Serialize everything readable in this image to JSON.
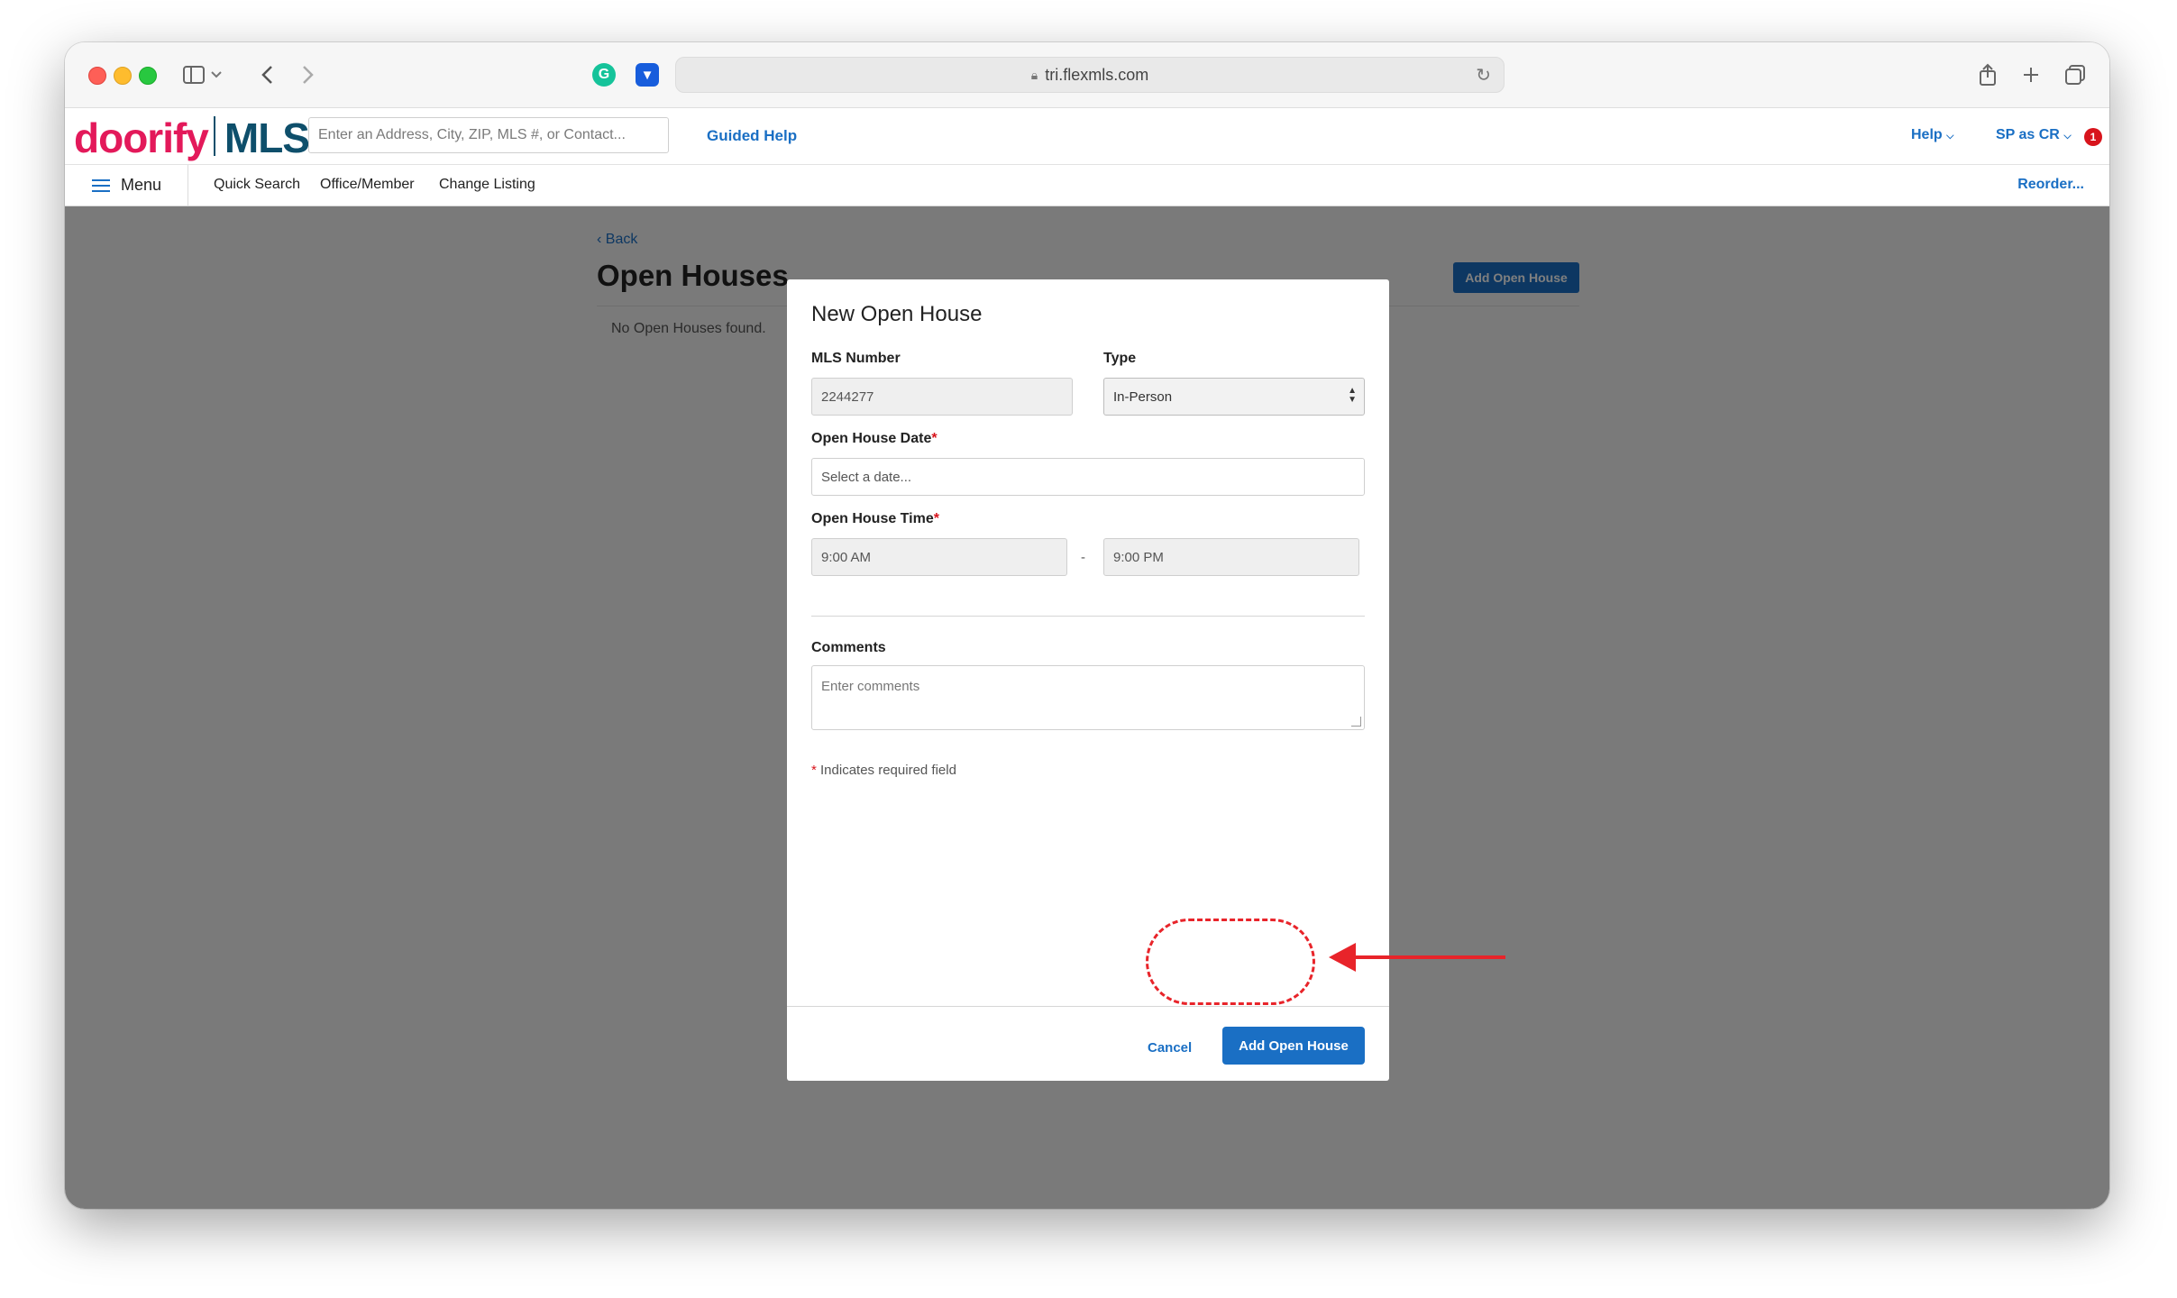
{
  "browser": {
    "url": "tri.flexmls.com",
    "icons": [
      "sidebar-icon",
      "chevron-down-icon",
      "back-icon",
      "forward-icon",
      "grammarly-icon",
      "bitwarden-icon",
      "lock-icon",
      "reload-icon",
      "share-icon",
      "new-tab-icon",
      "tabs-icon"
    ]
  },
  "header": {
    "logo_part1": "doorify",
    "logo_part2": "MLS",
    "search_placeholder": "Enter an Address, City, ZIP, MLS #, or Contact...",
    "guided_help": "Guided Help",
    "help": "Help",
    "user": "SP as CR",
    "notification_count": "1"
  },
  "nav": {
    "menu": "Menu",
    "items": [
      "Quick Search",
      "Office/Member",
      "Change Listing"
    ],
    "reorder": "Reorder..."
  },
  "page": {
    "back": "Back",
    "title": "Open Houses",
    "add_button": "Add Open House",
    "empty_text": "No Open Houses found."
  },
  "modal": {
    "title": "New Open House",
    "mls_label": "MLS Number",
    "mls_value": "2244277",
    "type_label": "Type",
    "type_value": "In-Person",
    "date_label": "Open House Date",
    "date_placeholder": "Select a date...",
    "time_label": "Open House Time",
    "time_start": "9:00 AM",
    "time_separator": "-",
    "time_end": "9:00 PM",
    "comments_label": "Comments",
    "comments_placeholder": "Enter comments",
    "required_mark": "*",
    "required_note": "Indicates required field",
    "cancel": "Cancel",
    "submit": "Add Open House"
  },
  "colors": {
    "brand_pink": "#e3195a",
    "brand_teal": "#0e4f6b",
    "primary_blue": "#1a6fc4",
    "annotation_red": "#e8242a"
  }
}
